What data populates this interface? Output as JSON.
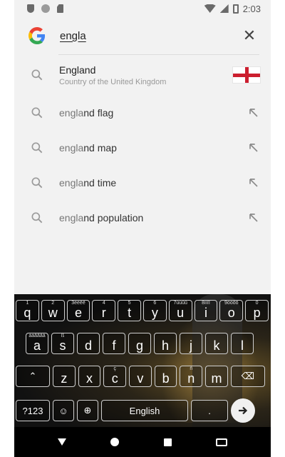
{
  "status_bar": {
    "time": "2:03"
  },
  "search": {
    "query": "engla"
  },
  "suggestions": [
    {
      "title": "England",
      "subtitle": "Country of the United Kingdom"
    },
    {
      "typed": "engla",
      "rest": "nd flag"
    },
    {
      "typed": "engla",
      "rest": "nd map"
    },
    {
      "typed": "engla",
      "rest": "nd time"
    },
    {
      "typed": "engla",
      "rest": "nd population"
    }
  ],
  "keyboard": {
    "row1": [
      {
        "k": "q",
        "h": "1"
      },
      {
        "k": "w",
        "h": "2"
      },
      {
        "k": "e",
        "h": "3èéêë"
      },
      {
        "k": "r",
        "h": "4"
      },
      {
        "k": "t",
        "h": "5"
      },
      {
        "k": "y",
        "h": "6"
      },
      {
        "k": "u",
        "h": "7ùúûü"
      },
      {
        "k": "i",
        "h": "8ìíîï"
      },
      {
        "k": "o",
        "h": "9òóôõ"
      },
      {
        "k": "p",
        "h": "0"
      }
    ],
    "row2": [
      {
        "k": "a",
        "h": "àáâãäå"
      },
      {
        "k": "s",
        "h": "ß"
      },
      {
        "k": "d",
        "h": ""
      },
      {
        "k": "f",
        "h": ""
      },
      {
        "k": "g",
        "h": ""
      },
      {
        "k": "h",
        "h": ""
      },
      {
        "k": "j",
        "h": ""
      },
      {
        "k": "k",
        "h": ""
      },
      {
        "k": "l",
        "h": ""
      }
    ],
    "row3": [
      {
        "k": "z",
        "h": ""
      },
      {
        "k": "x",
        "h": ""
      },
      {
        "k": "c",
        "h": "ç"
      },
      {
        "k": "v",
        "h": ""
      },
      {
        "k": "b",
        "h": ""
      },
      {
        "k": "n",
        "h": "ñ"
      },
      {
        "k": "m",
        "h": ""
      }
    ],
    "symbols_label": "?123",
    "space_label": "English"
  },
  "colors": {
    "flag_red": "#cc1f2f",
    "screen_bg": "#f2f2f2"
  }
}
